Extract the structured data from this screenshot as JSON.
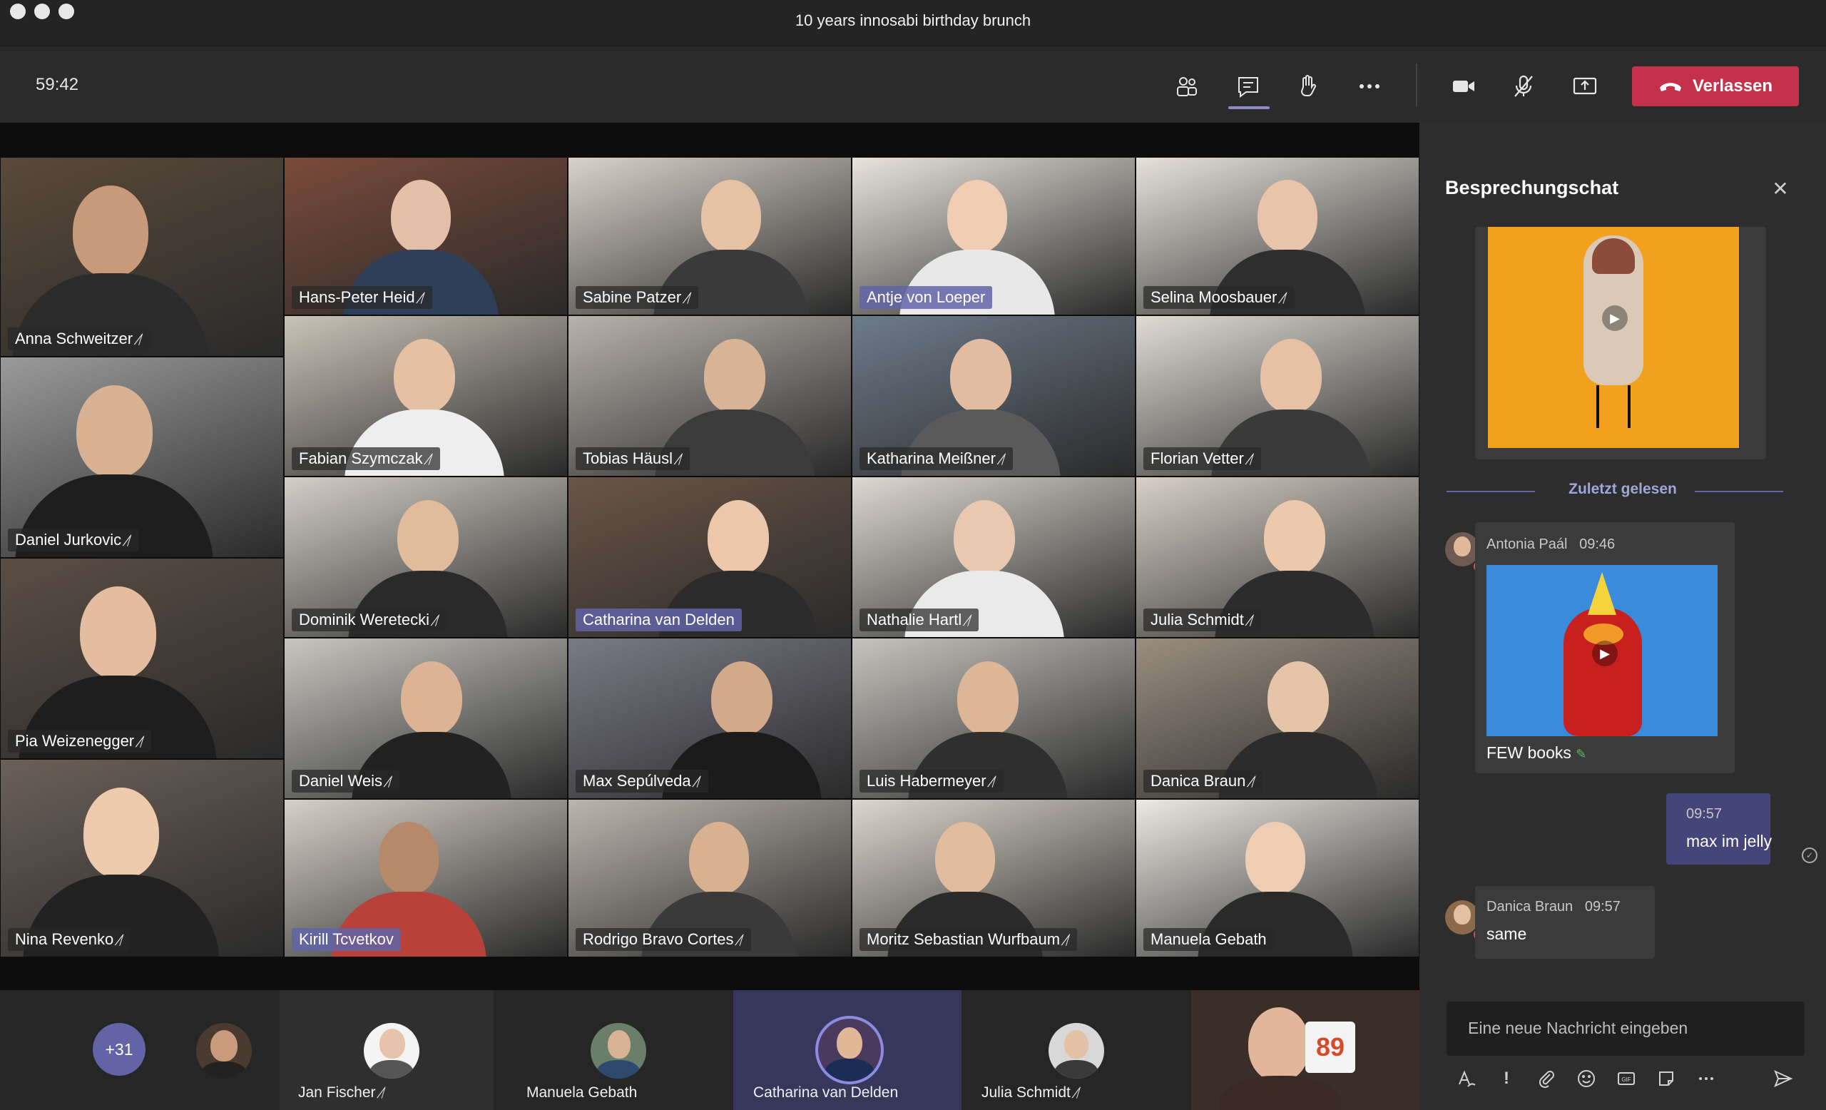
{
  "window": {
    "title": "10 years innosabi birthday brunch"
  },
  "toolbar": {
    "timer": "59:42",
    "buttons": [
      "participants-icon",
      "chat-icon",
      "raise-hand-icon",
      "more-icon",
      "camera-icon",
      "mic-muted-icon",
      "share-screen-icon"
    ],
    "leave_label": "Verlassen",
    "leave_color": "#c4314b"
  },
  "tiles": [
    {
      "name": "Anna Schweitzer",
      "muted": true,
      "highlight": false
    },
    {
      "name": "Hans-Peter Heid",
      "muted": true,
      "highlight": false
    },
    {
      "name": "Sabine Patzer",
      "muted": true,
      "highlight": false
    },
    {
      "name": "Antje von Loeper",
      "muted": false,
      "highlight": true
    },
    {
      "name": "Selina Moosbauer",
      "muted": true,
      "highlight": false
    },
    {
      "name": "Daniel Jurkovic",
      "muted": true,
      "highlight": false
    },
    {
      "name": "Fabian Szymczak",
      "muted": true,
      "highlight": false
    },
    {
      "name": "Tobias Häusl",
      "muted": true,
      "highlight": false
    },
    {
      "name": "Katharina Meißner",
      "muted": true,
      "highlight": false
    },
    {
      "name": "Florian Vetter",
      "muted": true,
      "highlight": false
    },
    {
      "name": "Pia Weizenegger",
      "muted": true,
      "highlight": false
    },
    {
      "name": "Dominik Weretecki",
      "muted": true,
      "highlight": false
    },
    {
      "name": "Catharina van Delden",
      "muted": false,
      "highlight": true
    },
    {
      "name": "Nathalie Hartl",
      "muted": true,
      "highlight": false
    },
    {
      "name": "Julia Schmidt",
      "muted": true,
      "highlight": false
    },
    {
      "name": "Nina Revenko",
      "muted": true,
      "highlight": false
    },
    {
      "name": "Daniel Weis",
      "muted": true,
      "highlight": false
    },
    {
      "name": "Max Sepúlveda",
      "muted": true,
      "highlight": false
    },
    {
      "name": "Luis Habermeyer",
      "muted": true,
      "highlight": false
    },
    {
      "name": "Danica Braun",
      "muted": true,
      "highlight": false
    },
    {
      "name": "Kirill Tcvetkov",
      "muted": false,
      "highlight": true
    },
    {
      "name": "Rodrigo Bravo Cortes",
      "muted": true,
      "highlight": false
    },
    {
      "name": "Moritz Sebastian Wurfbaum",
      "muted": true,
      "highlight": false
    },
    {
      "name": "Manuela Gebath",
      "muted": false,
      "highlight": false
    }
  ],
  "roster": {
    "more_count": "+31",
    "people": [
      {
        "name": "",
        "muted": false
      },
      {
        "name": "Jan Fischer",
        "muted": true
      },
      {
        "name": "Manuela Gebath",
        "muted": false
      },
      {
        "name": "Catharina van Delden",
        "muted": false
      },
      {
        "name": "Julia Schmidt",
        "muted": true
      }
    ]
  },
  "chat": {
    "title": "Besprechungschat",
    "last_read": "Zuletzt gelesen",
    "messages": [
      {
        "author": "Antonia Paál",
        "time": "09:46",
        "text": "FEW books"
      },
      {
        "author": "",
        "time": "09:57",
        "text": "max im jelly"
      },
      {
        "author": "Danica Braun",
        "time": "09:57",
        "text": "same"
      }
    ],
    "compose_placeholder": "Eine neue Nachricht eingeben",
    "compose_tools": [
      "format-icon",
      "important-icon",
      "attach-icon",
      "emoji-icon",
      "gif-icon",
      "sticker-icon",
      "more-options-icon",
      "send-icon"
    ]
  },
  "colors": {
    "accent": "#6264a7",
    "background": "#1f1f1f",
    "panel": "#2d2d2d"
  }
}
